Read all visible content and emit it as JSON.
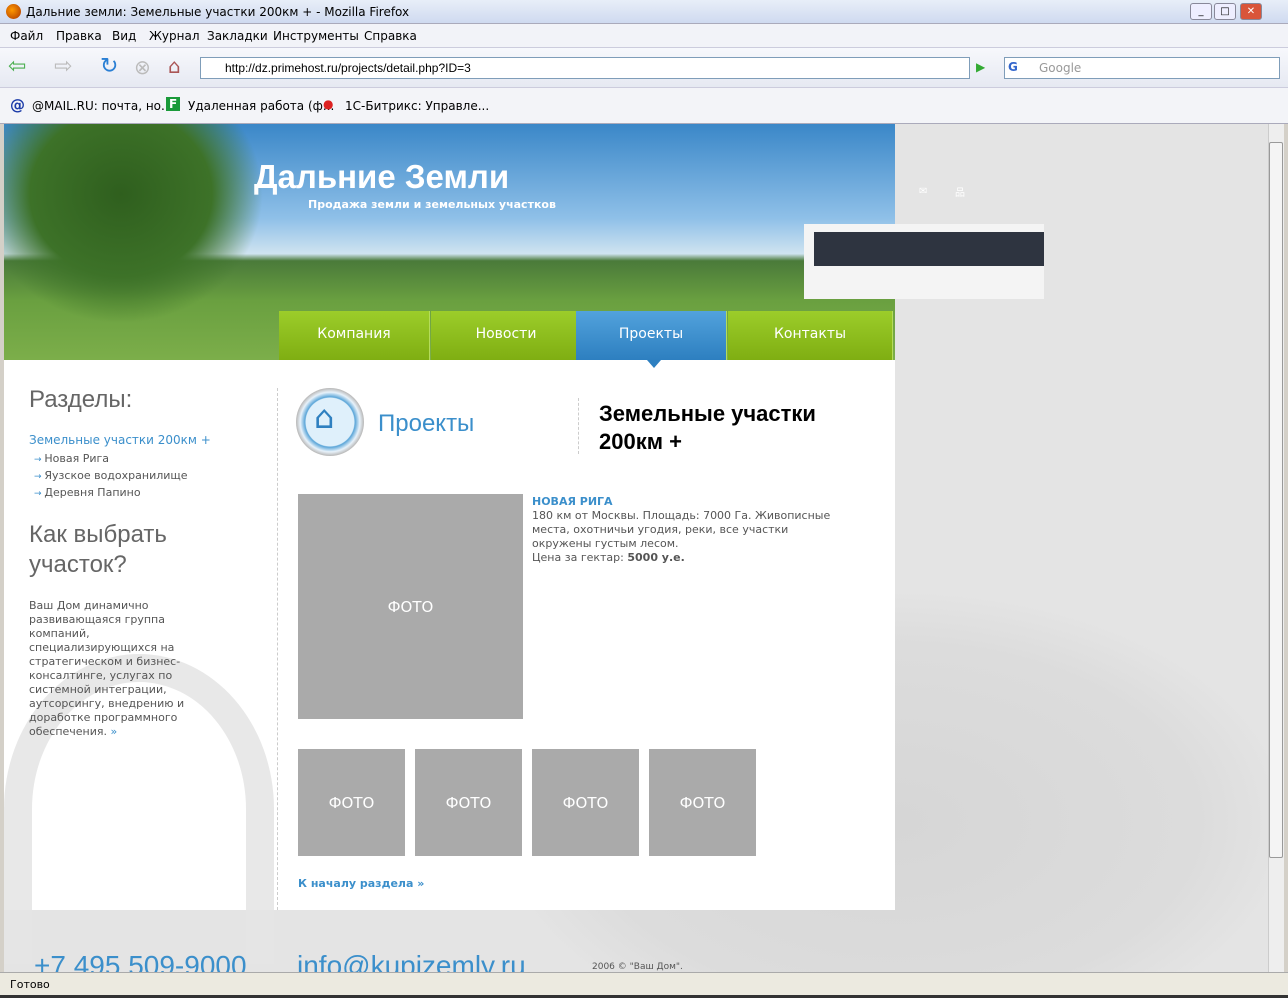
{
  "browser": {
    "title": "Дальние земли: Земельные участки 200км + - Mozilla Firefox",
    "menu": [
      "Файл",
      "Правка",
      "Вид",
      "Журнал",
      "Закладки",
      "Инструменты",
      "Справка"
    ],
    "url": "http://dz.primehost.ru/projects/detail.php?ID=3",
    "search_placeholder": "Google",
    "bookmarks": [
      "@MAIL.RU: почта, но...",
      "Удаленная работа (ф...",
      "1С-Битрикс: Управле..."
    ],
    "status": "Готово"
  },
  "site": {
    "logo": "Дальние Земли",
    "slogan": "Продажа земли и земельных участков",
    "nav": [
      {
        "label": "Компания"
      },
      {
        "label": "Новости"
      },
      {
        "label": "Проекты",
        "active": true
      },
      {
        "label": "Контакты"
      }
    ],
    "accent": "#3b8fcb",
    "nav_color": "#8fc11e"
  },
  "sidebar": {
    "heading": "Разделы:",
    "current": "Земельные участки 200км +",
    "items": [
      "Новая Рига",
      "Яузское водохранилище",
      "Деревня Папино"
    ],
    "how_heading": "Как выбрать участок?",
    "how_text": "Ваш Дом динамично развивающаяся группа компаний, специализирующихся на стратегическом и бизнес-консалтинге, услугах по системной интеграции, аутсорсингу, внедрению и доработке программного обеспечения.",
    "more": "»"
  },
  "main": {
    "section": "Проекты",
    "title": "Земельные участки 200км +",
    "project": {
      "name": "НОВАЯ РИГА",
      "desc": "180 км от Москвы. Площадь: 7000 Га. Живописные места, охотничьи угодия, реки, все участки окружены густым лесом.",
      "price_label": "Цена за гектар:",
      "price": "5000 у.е."
    },
    "photo_label": "ФОТО",
    "back": "К началу раздела »"
  },
  "footer": {
    "phone": "+7 495 509-9000",
    "email": "info@kupizemly.ru",
    "copyright": "2006 © \"Ваш Дом\"."
  }
}
